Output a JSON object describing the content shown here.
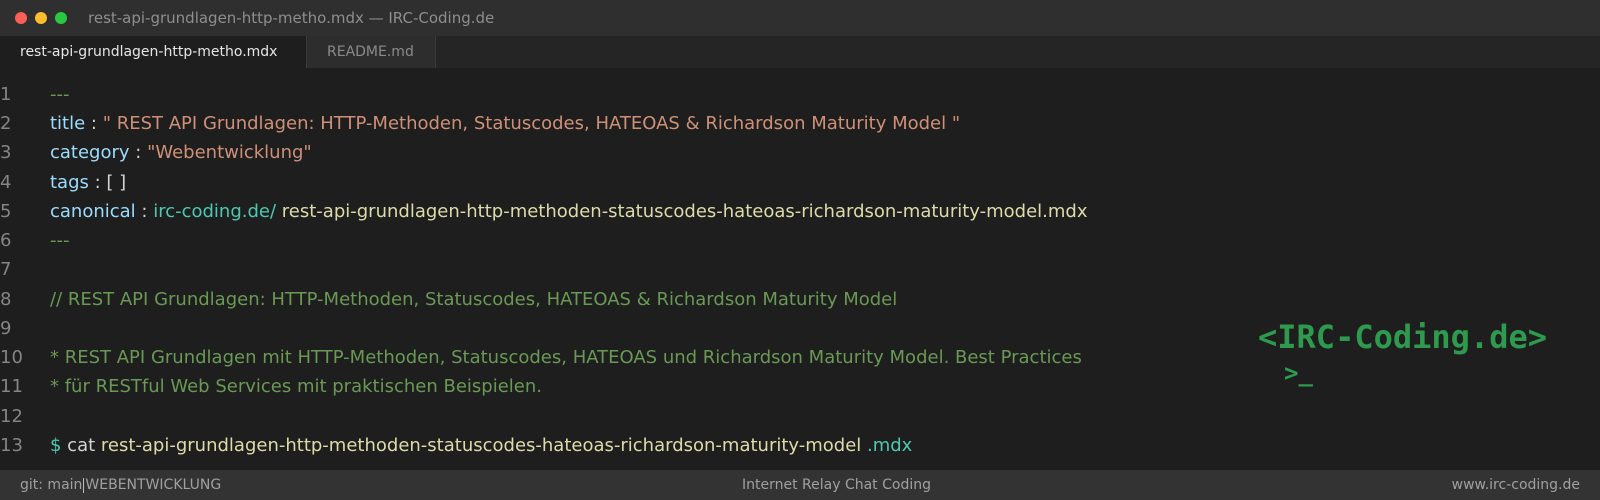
{
  "window": {
    "title": "rest-api-grundlagen-http-metho.mdx — IRC-Coding.de"
  },
  "tabs": [
    {
      "label": "rest-api-grundlagen-http-metho.mdx",
      "active": true
    },
    {
      "label": "README.md",
      "active": false
    }
  ],
  "editor": {
    "line_numbers": [
      "1",
      "2",
      "3",
      "4",
      "5",
      "6",
      "7",
      "8",
      "9",
      "10",
      "11",
      "12",
      "13"
    ],
    "l1": "---",
    "l2_key": "title",
    "l2_sep": " : ",
    "l2_val": "\" REST API Grundlagen: HTTP-Methoden, Statuscodes, HATEOAS & Richardson Maturity Model \"",
    "l3_key": "category",
    "l3_sep": " : ",
    "l3_val": "\"Webentwicklung\"",
    "l4_key": "tags",
    "l4_sep": " : ",
    "l4_val": "[ ]",
    "l5_key": "canonical",
    "l5_sep": " : ",
    "l5_host": "irc-coding.de/",
    "l5_path": " rest-api-grundlagen-http-methoden-statuscodes-hateoas-richardson-maturity-model.mdx",
    "l6": "---",
    "l8": "// REST API Grundlagen: HTTP-Methoden, Statuscodes, HATEOAS & Richardson Maturity Model",
    "l10": "* REST API Grundlagen mit HTTP-Methoden, Statuscodes, HATEOAS und Richardson Maturity Model. Best Practices",
    "l11": "* für RESTful Web Services mit praktischen Beispielen.",
    "l13_prompt": "$",
    "l13_cmd": " cat",
    "l13_file": " rest-api-grundlagen-http-methoden-statuscodes-hateoas-richardson-maturity-model",
    "l13_ext": " .mdx"
  },
  "brand": {
    "logo": "<IRC-Coding.de>",
    "prompt": ">_"
  },
  "statusbar": {
    "branch": "git: main",
    "category": "WEBENTWICKLUNG",
    "center": "Internet Relay Chat Coding",
    "right": "www.irc-coding.de"
  },
  "colors": {
    "comment": "#6a9955",
    "key": "#9cdcfe",
    "string": "#ce9178",
    "link": "#4ec9b0",
    "brand": "#2e9a4e"
  }
}
